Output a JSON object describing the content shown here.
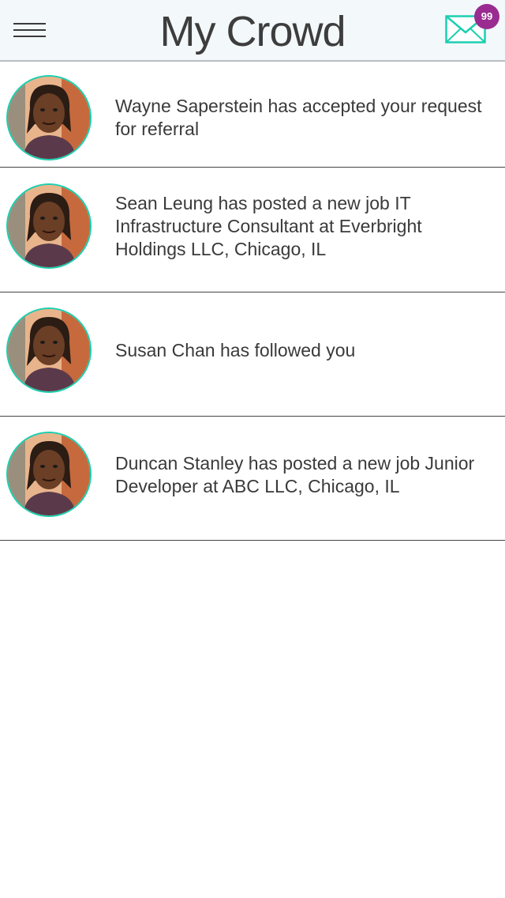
{
  "header": {
    "title": "My Crowd",
    "badge_count": "99",
    "menu_icon": "hamburger-icon",
    "mail_icon": "envelope-icon"
  },
  "colors": {
    "accent": "#1bcfb0",
    "badge": "#9a2c91",
    "header_bg": "#f3f8fb"
  },
  "notifications": [
    {
      "text": "Wayne Saperstein has accepted your request for referral"
    },
    {
      "text": "Sean Leung has posted a new job IT Infrastructure Consultant at Everbright Holdings LLC, Chicago, IL"
    },
    {
      "text": "Susan Chan has followed you"
    },
    {
      "text": "Duncan Stanley has posted a new job Junior Developer at ABC LLC, Chicago, IL"
    }
  ]
}
